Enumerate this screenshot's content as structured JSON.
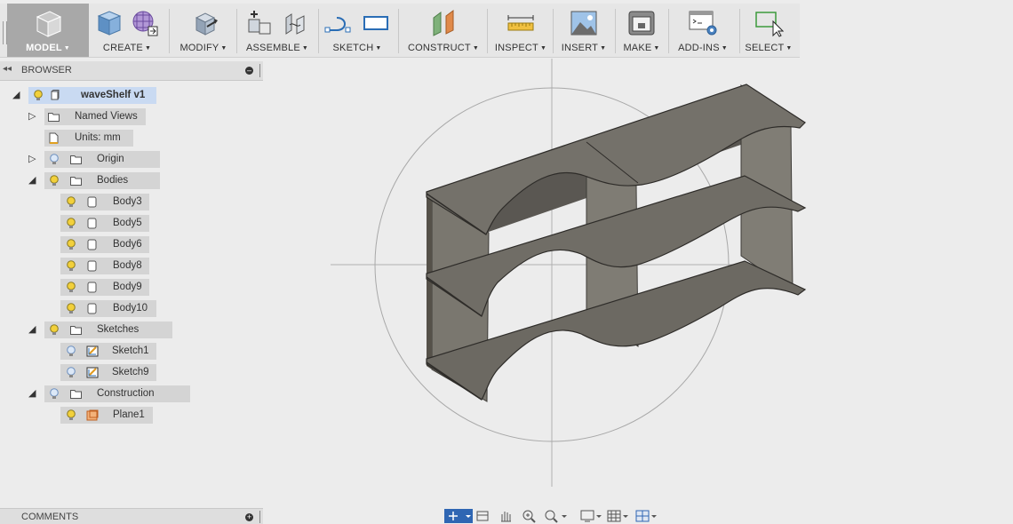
{
  "toolbar": {
    "workspace": "MODEL",
    "groups": [
      {
        "label": "CREATE"
      },
      {
        "label": "MODIFY"
      },
      {
        "label": "ASSEMBLE"
      },
      {
        "label": "SKETCH"
      },
      {
        "label": "CONSTRUCT"
      },
      {
        "label": "INSPECT"
      },
      {
        "label": "INSERT"
      },
      {
        "label": "MAKE"
      },
      {
        "label": "ADD-INS"
      },
      {
        "label": "SELECT"
      }
    ]
  },
  "browser": {
    "title": "BROWSER",
    "root": "waveShelf v1",
    "named_views": "Named Views",
    "units": "Units: mm",
    "origin": "Origin",
    "bodies_label": "Bodies",
    "bodies": [
      "Body3",
      "Body5",
      "Body6",
      "Body8",
      "Body9",
      "Body10"
    ],
    "sketches_label": "Sketches",
    "sketches": [
      "Sketch1",
      "Sketch9"
    ],
    "construction_label": "Construction",
    "planes": [
      "Plane1"
    ]
  },
  "comments": {
    "title": "COMMENTS"
  },
  "icons": {
    "bulb_on": "lightbulb-on-icon",
    "bulb_off": "lightbulb-off-icon",
    "folder": "folder-icon",
    "body": "body-icon",
    "sketch": "sketch-icon",
    "plane": "plane-icon"
  },
  "colors": {
    "bulb_on": "#f2d03b",
    "bulb_off": "#9fbbe0",
    "selected": "#c9daf2",
    "shelf": "#6d6a64"
  }
}
